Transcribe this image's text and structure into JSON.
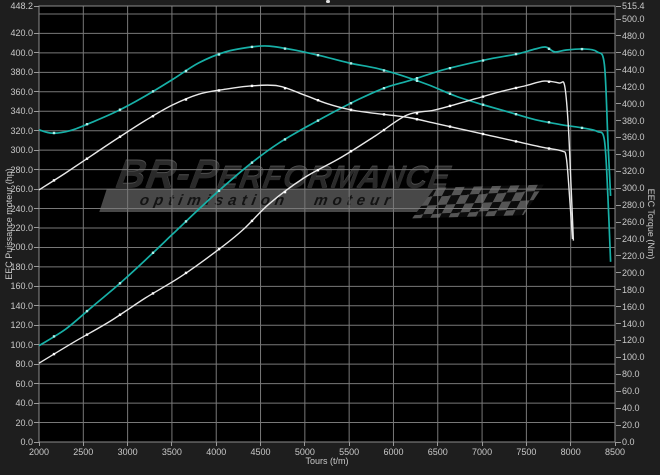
{
  "colors": {
    "outer_bg": "#1e1e1e",
    "plot_bg": "#000000",
    "grid": "#787878",
    "border": "#8c8c8c",
    "accent_cyan": "#17b0a7",
    "cyan_marker": "#aef0ea",
    "curve_white": "#e8e8e8",
    "white_marker": "#ffffff",
    "label": "#c9c9c9"
  },
  "chart_data": {
    "type": "line",
    "title": "",
    "legend": "none",
    "grid": "on",
    "x_axis": {
      "label": "Tours (t/m)",
      "min": 2000,
      "max": 8500,
      "tick_step": 500,
      "ticks": [
        "2000",
        "2500",
        "3000",
        "3500",
        "4000",
        "4500",
        "5000",
        "5500",
        "6000",
        "6500",
        "7000",
        "7500",
        "8000",
        "8500"
      ]
    },
    "y_left": {
      "label": "EEC Puissance moteur (hp)",
      "min": 0,
      "max": 448.2,
      "grid_step": 20,
      "ticks": [
        {
          "label": "448.2",
          "value": 448.2
        },
        {
          "label": "420.0",
          "value": 420
        },
        {
          "label": "400.0",
          "value": 400
        },
        {
          "label": "380.0",
          "value": 380
        },
        {
          "label": "360.0",
          "value": 360
        },
        {
          "label": "340.0",
          "value": 340
        },
        {
          "label": "320.0",
          "value": 320
        },
        {
          "label": "300.0",
          "value": 300
        },
        {
          "label": "280.0",
          "value": 280
        },
        {
          "label": "260.0",
          "value": 260
        },
        {
          "label": "240.0",
          "value": 240
        },
        {
          "label": "220.0",
          "value": 220
        },
        {
          "label": "200.0",
          "value": 200
        },
        {
          "label": "180.0",
          "value": 180
        },
        {
          "label": "160.0",
          "value": 160
        },
        {
          "label": "140.0",
          "value": 140
        },
        {
          "label": "120.0",
          "value": 120
        },
        {
          "label": "100.0",
          "value": 100
        },
        {
          "label": "80.0",
          "value": 80
        },
        {
          "label": "60.0",
          "value": 60
        },
        {
          "label": "40.0",
          "value": 40
        },
        {
          "label": "20.0",
          "value": 20
        },
        {
          "label": "0.0",
          "value": 0
        }
      ]
    },
    "y_right": {
      "label": "EEC Torque (Nm)",
      "min": 0,
      "max": 515.4,
      "ticks": [
        {
          "label": "515.4",
          "value": 515.4
        },
        {
          "label": "500.0",
          "value": 500
        },
        {
          "label": "480.0",
          "value": 480
        },
        {
          "label": "460.0",
          "value": 460
        },
        {
          "label": "440.0",
          "value": 440
        },
        {
          "label": "420.0",
          "value": 420
        },
        {
          "label": "400.0",
          "value": 400
        },
        {
          "label": "380.0",
          "value": 380
        },
        {
          "label": "360.0",
          "value": 360
        },
        {
          "label": "340.0",
          "value": 340
        },
        {
          "label": "320.0",
          "value": 320
        },
        {
          "label": "300.0",
          "value": 300
        },
        {
          "label": "280.0",
          "value": 280
        },
        {
          "label": "260.0",
          "value": 260
        },
        {
          "label": "240.0",
          "value": 240
        },
        {
          "label": "220.0",
          "value": 220
        },
        {
          "label": "200.0",
          "value": 200
        },
        {
          "label": "180.0",
          "value": 180
        },
        {
          "label": "160.0",
          "value": 160
        },
        {
          "label": "140.0",
          "value": 140
        },
        {
          "label": "120.0",
          "value": 120
        },
        {
          "label": "100.0",
          "value": 100
        },
        {
          "label": "80.0",
          "value": 80
        },
        {
          "label": "60.0",
          "value": 60
        },
        {
          "label": "40.0",
          "value": 40
        },
        {
          "label": "20.0",
          "value": 20
        },
        {
          "label": "0.0",
          "value": 0
        }
      ]
    },
    "series": [
      {
        "id": "puissance-optimisee",
        "axis": "left",
        "color": "#17b0a7",
        "marker": "#aef0ea",
        "width": 1.7,
        "points": [
          [
            2000,
            99
          ],
          [
            2300,
            116
          ],
          [
            2600,
            139
          ],
          [
            2900,
            162
          ],
          [
            3200,
            187
          ],
          [
            3500,
            213
          ],
          [
            3800,
            239
          ],
          [
            4100,
            264
          ],
          [
            4400,
            287
          ],
          [
            4700,
            307
          ],
          [
            5000,
            323
          ],
          [
            5300,
            338
          ],
          [
            5600,
            352
          ],
          [
            5900,
            364
          ],
          [
            6200,
            372
          ],
          [
            6500,
            381
          ],
          [
            6800,
            388
          ],
          [
            7100,
            394
          ],
          [
            7400,
            399
          ],
          [
            7600,
            404
          ],
          [
            7720,
            406
          ],
          [
            7820,
            401
          ],
          [
            7950,
            403
          ],
          [
            8150,
            404
          ],
          [
            8300,
            401
          ],
          [
            8380,
            388
          ],
          [
            8420,
            310
          ],
          [
            8450,
            253
          ]
        ]
      },
      {
        "id": "couple-optimise",
        "axis": "right",
        "color": "#17b0a7",
        "marker": "#aef0ea",
        "width": 1.7,
        "points": [
          [
            2000,
            369
          ],
          [
            2150,
            365
          ],
          [
            2350,
            368
          ],
          [
            2600,
            378
          ],
          [
            2900,
            392
          ],
          [
            3200,
            409
          ],
          [
            3500,
            428
          ],
          [
            3800,
            448
          ],
          [
            4100,
            461
          ],
          [
            4400,
            467
          ],
          [
            4600,
            468
          ],
          [
            4900,
            463
          ],
          [
            5200,
            456
          ],
          [
            5500,
            448
          ],
          [
            5800,
            442
          ],
          [
            6100,
            433
          ],
          [
            6400,
            422
          ],
          [
            6700,
            409
          ],
          [
            7000,
            399
          ],
          [
            7300,
            390
          ],
          [
            7600,
            381
          ],
          [
            7900,
            375
          ],
          [
            8150,
            371
          ],
          [
            8300,
            367
          ],
          [
            8380,
            357
          ],
          [
            8420,
            290
          ],
          [
            8450,
            213
          ]
        ]
      },
      {
        "id": "puissance-origine",
        "axis": "left",
        "color": "#e8e8e8",
        "marker": "#ffffff",
        "width": 1.4,
        "points": [
          [
            2000,
            81
          ],
          [
            2400,
            103
          ],
          [
            2800,
            124
          ],
          [
            3200,
            148
          ],
          [
            3600,
            170
          ],
          [
            4000,
            196
          ],
          [
            4300,
            218
          ],
          [
            4600,
            245
          ],
          [
            5000,
            272
          ],
          [
            5400,
            292
          ],
          [
            5800,
            315
          ],
          [
            6150,
            336
          ],
          [
            6450,
            341
          ],
          [
            6700,
            347
          ],
          [
            6930,
            353
          ],
          [
            7200,
            360
          ],
          [
            7480,
            366
          ],
          [
            7700,
            371
          ],
          [
            7870,
            369
          ],
          [
            7930,
            367
          ],
          [
            7970,
            330
          ],
          [
            8000,
            272
          ],
          [
            8030,
            207
          ]
        ]
      },
      {
        "id": "couple-origine",
        "axis": "right",
        "color": "#e8e8e8",
        "marker": "#ffffff",
        "width": 1.4,
        "points": [
          [
            2000,
            298
          ],
          [
            2300,
            318
          ],
          [
            2600,
            339
          ],
          [
            2900,
            360
          ],
          [
            3200,
            380
          ],
          [
            3500,
            398
          ],
          [
            3800,
            411
          ],
          [
            4100,
            417
          ],
          [
            4400,
            421
          ],
          [
            4700,
            421
          ],
          [
            5000,
            410
          ],
          [
            5250,
            400
          ],
          [
            5500,
            393
          ],
          [
            5750,
            389
          ],
          [
            6000,
            386
          ],
          [
            6200,
            383
          ],
          [
            6500,
            376
          ],
          [
            6800,
            369
          ],
          [
            7100,
            362
          ],
          [
            7400,
            355
          ],
          [
            7700,
            348
          ],
          [
            7900,
            344
          ],
          [
            7950,
            336
          ],
          [
            7990,
            286
          ],
          [
            8020,
            240
          ]
        ]
      }
    ]
  },
  "watermark": {
    "brand_big": "BR-P",
    "brand_rest": "ERFORMANCE",
    "tagline": "optimisation moteur"
  }
}
